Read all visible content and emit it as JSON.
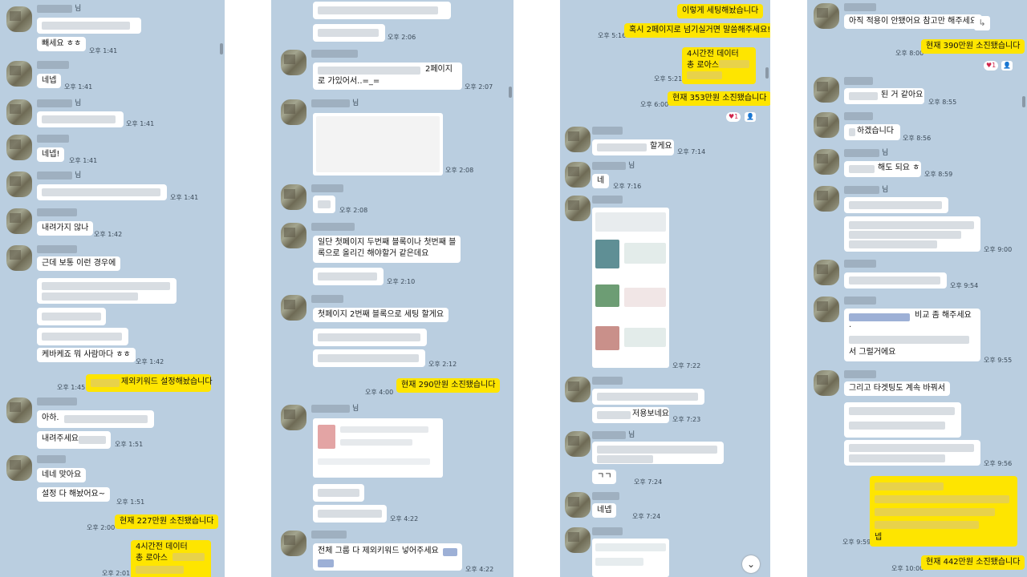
{
  "colors": {
    "chat_bg": "#bacee0",
    "bubble_white": "#ffffff",
    "bubble_yellow": "#fee500",
    "reaction": "#d0254b"
  },
  "panel1": {
    "name_suffix_1": "님",
    "msg_1": "빼세요 ㅎㅎ",
    "time_1": "오후 1:41",
    "msg_2": "네넵",
    "time_2": "오후 1:41",
    "name_suffix_3": "님",
    "time_3": "오후 1:41",
    "msg_4": "네넵!",
    "time_4": "오후 1:41",
    "name_suffix_5": "님",
    "time_5": "오후 1:41",
    "msg_6": "내려가지 않나",
    "time_6": "오후 1:42",
    "msg_7a": "근데 보통 이런 경우에",
    "msg_7b": "케바케죠 뭐 사람마다 ㅎㅎ",
    "time_7": "오후 1:42",
    "my_msg_1": "제외키워드 설정해놨습니다",
    "my_time_1": "오후 1:45",
    "msg_8a": "아하.",
    "msg_8b": "내려주세요",
    "time_8": "오후 1:51",
    "msg_9a": "네네 맞아요",
    "msg_9b": "설정 다 해놨어요~",
    "time_9": "오후 1:51",
    "my_msg_2": "현재 227만원 소진됐습니다",
    "my_time_2": "오후 2:00",
    "my_msg_3a": "4시간전 데이터",
    "my_msg_3b": "총 로아스",
    "my_time_3": "오후 2:01"
  },
  "panel2": {
    "time_1": "오후 2:06",
    "msg_2a": "2페이지",
    "msg_2b": "로 가있어서..=_=",
    "time_2": "오후 2:07",
    "name_suffix_3": "님",
    "time_3": "오후 2:08",
    "time_4": "오후 2:08",
    "msg_5a": "일단 첫페이지 두번째 블록이나 첫번째 블",
    "msg_5b": "록으로 올리긴 해야할거 같은데요",
    "time_5": "오후 2:10",
    "msg_6": "첫페이지 2번째 블록으로 세팅 할게요",
    "time_6": "오후 2:12",
    "my_msg_1": "현재 290만원 소진됐습니다",
    "my_time_1": "오후 4:00",
    "name_suffix_7": "님",
    "time_7": "오후 4:22",
    "msg_8": "전체 그룹 다 제외키워드 넣어주세요",
    "time_8": "오후 4:22"
  },
  "panel3": {
    "my_msg_1": "이렇게 세팅해놨습니다",
    "my_msg_2": "혹시 2페이지로 넘기실거면 말씀해주세요!",
    "my_time_2": "오후 5:16",
    "my_msg_3a": "4시간전 데이터",
    "my_msg_3b": "총 로아스",
    "my_time_3": "오후 5:21",
    "my_msg_4": "현재 353만원 소진됐습니다",
    "my_time_4": "오후 6:00",
    "reaction_4": "♥1",
    "msg_5": "할게요",
    "time_5": "오후 7:14",
    "name_suffix_6": "님",
    "msg_6": "네",
    "time_6": "오후 7:16",
    "time_7": "오후 7:22",
    "msg_8": "저용보네요",
    "time_8": "오후 7:23",
    "name_suffix_9": "님",
    "msg_9": "ㄱㄱ",
    "time_9": "오후 7:24",
    "msg_10": "네넵",
    "time_10": "오후 7:24",
    "scroll_down": "⌄"
  },
  "panel4": {
    "msg_1": "아직 적용이 안됐어요 참고만 해주세요",
    "forward_icon": "↳",
    "my_msg_1": "현재 390만원 소진됐습니다",
    "my_time_1": "오후 8:00",
    "reaction_1": "♥1",
    "msg_2": "된 거 같아요",
    "time_2": "오후 8:55",
    "msg_3": "하겠습니다",
    "time_3": "오후 8:56",
    "name_suffix_4": "님",
    "msg_4": "해도 되요 ㅎ",
    "time_4": "오후 8:59",
    "name_suffix_5": "님",
    "time_5": "오후 9:00",
    "time_6": "오후 9:54",
    "msg_7a": "비교 좀 해주세요",
    "msg_7b": ".",
    "msg_7c": "서 그럴거에요",
    "time_7": "오후 9:55",
    "msg_8": "그리고 타겟팅도 계속 바꿔서",
    "time_8": "오후 9:56",
    "my_msg_2": "넵",
    "my_time_2": "오후 9:59",
    "my_msg_3": "현재 442만원 소진됐습니다",
    "my_time_3": "오후 10:00"
  }
}
